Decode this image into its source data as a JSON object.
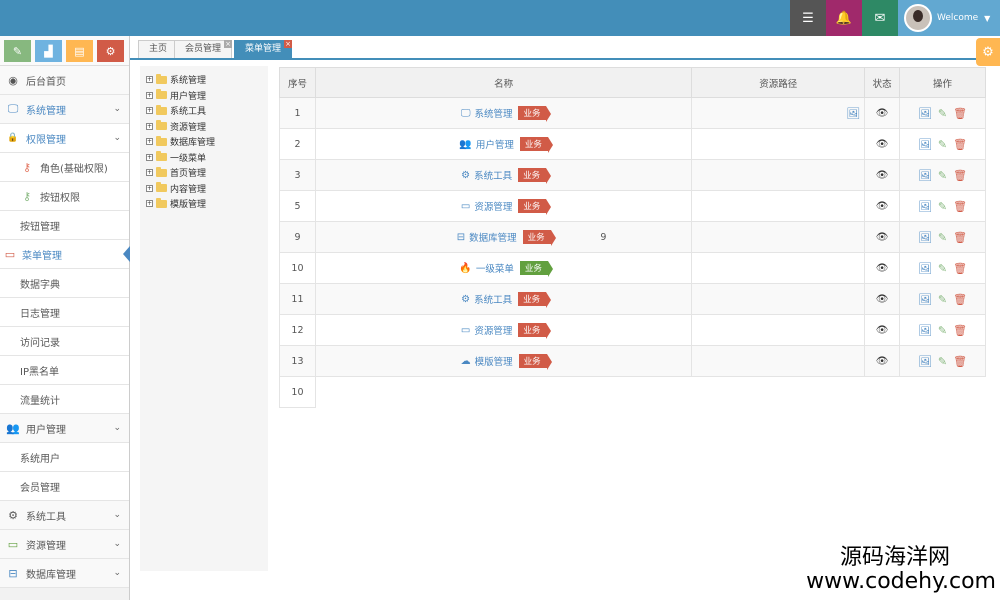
{
  "topbar": {
    "user_greeting": "Welcome",
    "buttons": [
      {
        "icon": "tasks-icon",
        "glyph": "☰",
        "color": "#555555"
      },
      {
        "icon": "bell-icon",
        "glyph": "🔔",
        "color": "#a0296b"
      },
      {
        "icon": "envelope-icon",
        "glyph": "✉",
        "color": "#2e8965"
      }
    ]
  },
  "shortcuts": [
    {
      "icon": "pencil-icon",
      "glyph": "✎",
      "color": "#87b87f"
    },
    {
      "icon": "signal-icon",
      "glyph": "▟",
      "color": "#6fb3e0"
    },
    {
      "icon": "book-icon",
      "glyph": "▤",
      "color": "#ffb752"
    },
    {
      "icon": "cogs-icon",
      "glyph": "⚙",
      "color": "#d15b47"
    }
  ],
  "sidebar": {
    "home": "后台首页",
    "system": "系统管理",
    "permission": "权限管理",
    "role": "角色(基础权限)",
    "button_perm": "按钮权限",
    "button_mgmt": "按钮管理",
    "menu_mgmt": "菜单管理",
    "dict": "数据字典",
    "log": "日志管理",
    "access": "访问记录",
    "ip_blacklist": "IP黑名单",
    "traffic": "流量统计",
    "user_mgmt": "用户管理",
    "sys_user": "系统用户",
    "member": "会员管理",
    "tools": "系统工具",
    "resource": "资源管理",
    "database": "数据库管理"
  },
  "tabs": [
    {
      "label": "主页"
    },
    {
      "label": "会员管理"
    },
    {
      "label": "菜单管理"
    }
  ],
  "tree": [
    "系统管理",
    "用户管理",
    "系统工具",
    "资源管理",
    "数据库管理",
    "一级菜单",
    "首页管理",
    "内容管理",
    "模版管理"
  ],
  "table": {
    "headers": [
      "序号",
      "名称",
      "资源路径",
      "状态",
      "操作"
    ],
    "tag_label": "业务",
    "rows": [
      {
        "no": "1",
        "icon": "desktop-icon",
        "glyph": "🖵",
        "name": "系统管理",
        "path": "",
        "tag": "red",
        "path_icon": true
      },
      {
        "no": "2",
        "icon": "users-icon",
        "glyph": "👥",
        "name": "用户管理",
        "path": "",
        "tag": "red",
        "path_icon": false
      },
      {
        "no": "3",
        "icon": "cog-icon",
        "glyph": "⚙",
        "name": "系统工具",
        "path": "",
        "tag": "red",
        "path_icon": false
      },
      {
        "no": "5",
        "icon": "credit-card-icon",
        "glyph": "▭",
        "name": "资源管理",
        "path": "",
        "tag": "red",
        "path_icon": false
      },
      {
        "no": "9",
        "icon": "hdd-icon",
        "glyph": "⊟",
        "name": "数据库管理",
        "path": "9",
        "tag": "red",
        "path_icon": false
      },
      {
        "no": "10",
        "icon": "fire-icon",
        "glyph": "🔥",
        "name": "一级菜单",
        "path": "",
        "tag": "green",
        "path_icon": false
      },
      {
        "no": "11",
        "icon": "cog-icon",
        "glyph": "⚙",
        "name": "系统工具",
        "path": "",
        "tag": "red",
        "path_icon": false
      },
      {
        "no": "12",
        "icon": "credit-card-icon",
        "glyph": "▭",
        "name": "资源管理",
        "path": "",
        "tag": "red",
        "path_icon": false
      },
      {
        "no": "13",
        "icon": "cloud-icon",
        "glyph": "☁",
        "name": "模版管理",
        "path": "",
        "tag": "red",
        "path_icon": false
      }
    ],
    "footer_no": "10"
  },
  "watermark": {
    "line1": "源码海洋网",
    "line2": "www.codehy.com"
  }
}
